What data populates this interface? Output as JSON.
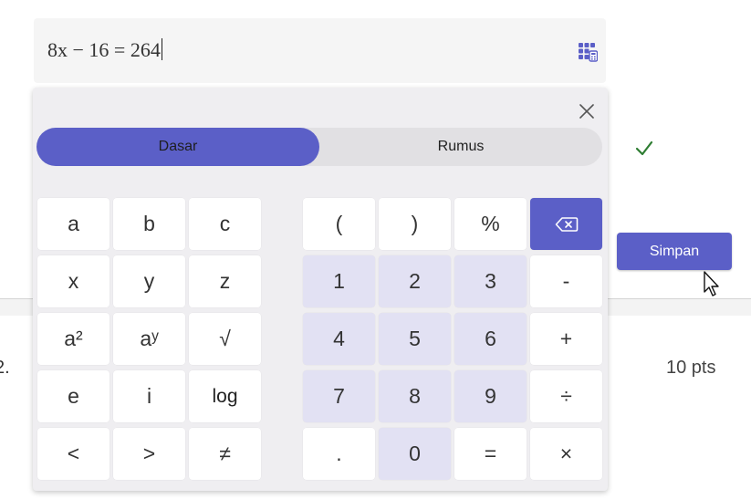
{
  "answer": {
    "expression": "8x − 16 = 264",
    "math_icon": "grid-math-icon"
  },
  "panel": {
    "close_icon": "close-icon",
    "tabs": [
      {
        "label": "Dasar",
        "selected": true
      },
      {
        "label": "Rumus",
        "selected": false
      }
    ],
    "letters": [
      [
        "a",
        "b",
        "c"
      ],
      [
        "x",
        "y",
        "z"
      ],
      [
        "a²",
        "aʸ",
        "√"
      ],
      [
        "e",
        "i",
        "log"
      ],
      [
        "<",
        ">",
        "≠"
      ]
    ],
    "numpad": [
      [
        "(",
        ")",
        "%",
        "backspace"
      ],
      [
        "1",
        "2",
        "3",
        "-"
      ],
      [
        "4",
        "5",
        "6",
        "+"
      ],
      [
        "7",
        "8",
        "9",
        "÷"
      ],
      [
        ".",
        "0",
        "=",
        "×"
      ]
    ]
  },
  "background": {
    "question_number": "2.",
    "points": "10 pts",
    "save_label": "Simpan",
    "check_icon": "checkmark-icon",
    "pointer_icon": "mouse-pointer-icon"
  },
  "colors": {
    "accent": "#5b5fc7",
    "number_key": "#e2e1f3",
    "panel_bg": "#efeef1",
    "check": "#2e7d32"
  }
}
